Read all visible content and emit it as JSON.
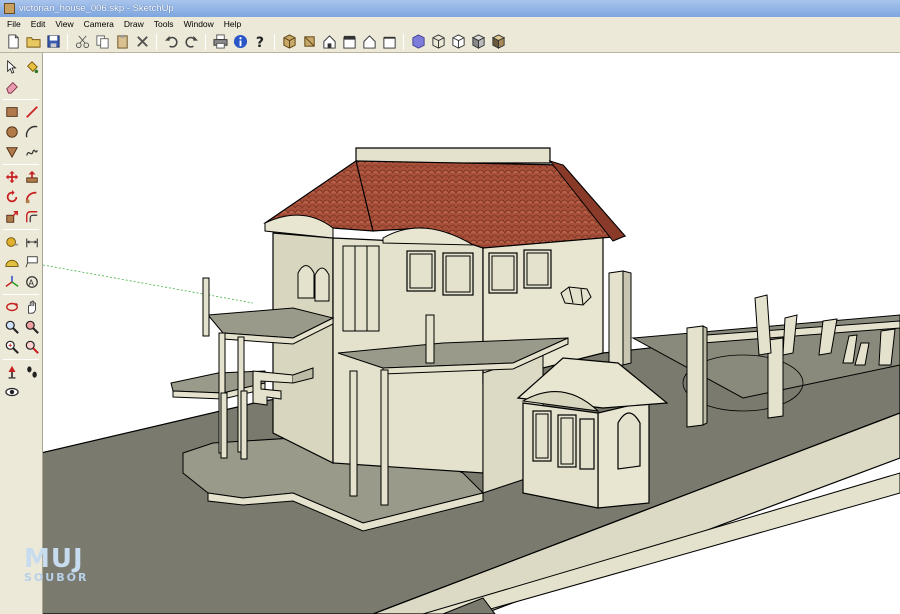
{
  "window": {
    "title": "victorian_house_006.skp - SketchUp"
  },
  "menu": {
    "items": [
      "File",
      "Edit",
      "View",
      "Camera",
      "Draw",
      "Tools",
      "Window",
      "Help"
    ]
  },
  "toolbar_icons": [
    "new-icon",
    "open-icon",
    "save-icon",
    "cut-icon",
    "copy-icon",
    "paste-icon",
    "erase-icon",
    "undo-icon",
    "redo-icon",
    "print-icon",
    "model-info-icon",
    "help-icon",
    "iso-view-icon",
    "top-view-icon",
    "front-view-icon",
    "right-view-icon",
    "back-view-icon",
    "left-view-icon",
    "xray-icon",
    "wireframe-icon",
    "hidden-line-icon",
    "shaded-icon",
    "textured-icon"
  ],
  "left_tools": [
    [
      "select-icon",
      "paint-bucket-icon"
    ],
    [
      "eraser-icon"
    ],
    [
      "rectangle-icon",
      "line-icon"
    ],
    [
      "circle-icon",
      "arc-icon"
    ],
    [
      "polygon-icon",
      "freehand-icon"
    ],
    [
      "move-icon",
      "push-pull-icon"
    ],
    [
      "rotate-icon",
      "follow-me-icon"
    ],
    [
      "scale-icon",
      "offset-icon"
    ],
    [
      "tape-measure-icon",
      "dimension-icon"
    ],
    [
      "protractor-icon",
      "text-icon"
    ],
    [
      "axes-icon",
      "3d-text-icon"
    ],
    [
      "orbit-icon",
      "pan-icon"
    ],
    [
      "zoom-icon",
      "zoom-window-icon"
    ],
    [
      "zoom-extents-icon",
      "previous-view-icon"
    ],
    [
      "position-camera-icon",
      "walk-icon"
    ],
    [
      "look-around-icon"
    ]
  ],
  "colors": {
    "ground": "#7a7a6e",
    "wall": "#e4e2cc",
    "roof": "#a8503a",
    "chrome": "#ece9d8",
    "titlebar": "#7ea6e0"
  },
  "watermark": {
    "line1": "MUJ",
    "line2": "SOUBOR"
  }
}
